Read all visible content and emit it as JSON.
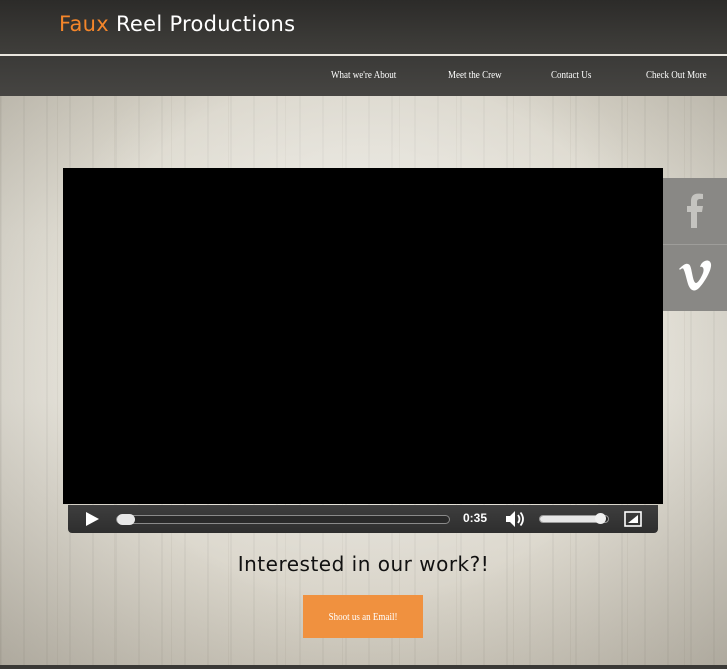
{
  "site": {
    "logo_accent": "Faux",
    "logo_rest": " Reel Productions"
  },
  "nav": {
    "items": [
      {
        "label": "What we're About"
      },
      {
        "label": "Meet the Crew"
      },
      {
        "label": "Contact Us"
      },
      {
        "label": "Check Out More"
      }
    ]
  },
  "video_player": {
    "time": "0:35",
    "progress": 0.0,
    "volume": 0.9
  },
  "social": {
    "items": [
      {
        "icon": "facebook-icon"
      },
      {
        "icon": "vimeo-icon"
      }
    ]
  },
  "cta": {
    "heading": "Interested in our work?!",
    "button_label": "Shoot us an Email!"
  },
  "colors": {
    "accent": "#f5862a",
    "header_bg": "#3a3936",
    "button_bg": "#f0913f"
  }
}
